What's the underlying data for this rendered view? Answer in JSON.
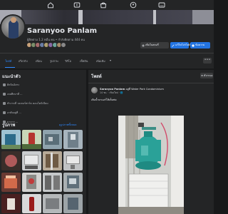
{
  "topnav": {
    "icons": [
      "home-icon",
      "video-icon",
      "marketplace-icon",
      "groups-icon",
      "gaming-icon"
    ]
  },
  "profile": {
    "name": "Saranyoo Panlam",
    "friends_line": "ผู้ติดตาม 1.2 หมื่น คน • กำลังติดตาม 444 คน",
    "buttons": {
      "add_story": "เพิ่มในสตอรี่",
      "edit_profile": "แก้ไขโปรไฟล์",
      "message": "ข้อความ"
    }
  },
  "tabs": {
    "items": [
      "โพสต์",
      "เกี่ยวกับ",
      "เพื่อน",
      "รูปภาพ",
      "วิดีโอ",
      "เช็คอิน",
      "เพิ่มเติม"
    ],
    "active_index": 0,
    "more_label": "•••"
  },
  "intro": {
    "title": "แนะนำตัว",
    "rows": [
      "ศิลปินอิสระ",
      "เคยศึกษาที่ ...",
      "ทำงานที่ วอเตอร์พาร์ค คอนโดมิเนียม",
      "อาศัยอยู่ที่ ...",
      "มาจาก ..."
    ]
  },
  "photos_section": {
    "title": "รูปภาพ",
    "link": "ดูรูปภาพทั้งหมด"
  },
  "posts": {
    "header": "โพสต์",
    "filter_label": "ตัวกรอง",
    "post": {
      "author": "Saranyoo Panlam",
      "author_suffix": "อยู่ที่ Water Park Condominium",
      "meta": "14 ชม. · เชียงใหม่ · 🌐",
      "text": "เติมน้ำยาแอร์ให้เต็มท่อ"
    }
  },
  "colors": {
    "background": "#18191a",
    "surface": "#242526",
    "accent": "#2d88ff",
    "button_blue": "#2374e1",
    "text_primary": "#e4e6eb",
    "text_secondary": "#b0b3b8"
  }
}
